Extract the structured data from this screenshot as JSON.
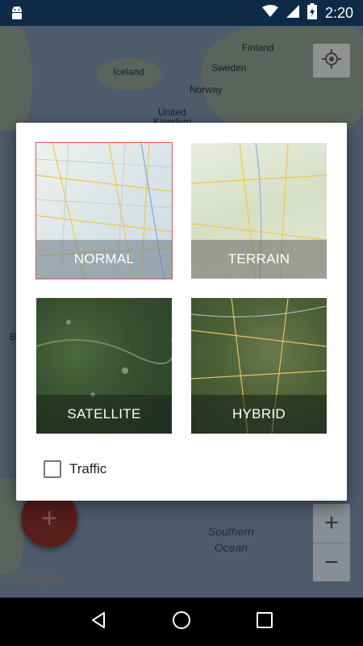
{
  "status_bar": {
    "time": "2:20",
    "icons": [
      "android-icon",
      "wifi-icon",
      "signal-icon",
      "battery-charging-icon"
    ],
    "background": "#0e2a47"
  },
  "map": {
    "labels": [
      "Finland",
      "Sweden",
      "Iceland",
      "Norway",
      "United",
      "Kingdom",
      "B",
      "Southern",
      "Ocean"
    ],
    "logo_text": "Google",
    "zoom_in": "+",
    "zoom_out": "−",
    "fab_label": "+"
  },
  "dialog": {
    "map_types": [
      {
        "label": "NORMAL",
        "selected": true
      },
      {
        "label": "TERRAIN",
        "selected": false
      },
      {
        "label": "SATELLITE",
        "selected": false
      },
      {
        "label": "HYBRID",
        "selected": false
      }
    ],
    "traffic": {
      "label": "Traffic",
      "checked": false
    }
  },
  "colors": {
    "accent_selected": "#e0554e",
    "fab": "#7a2a23",
    "caption_overlay": "rgba(0,0,0,0.35)"
  }
}
